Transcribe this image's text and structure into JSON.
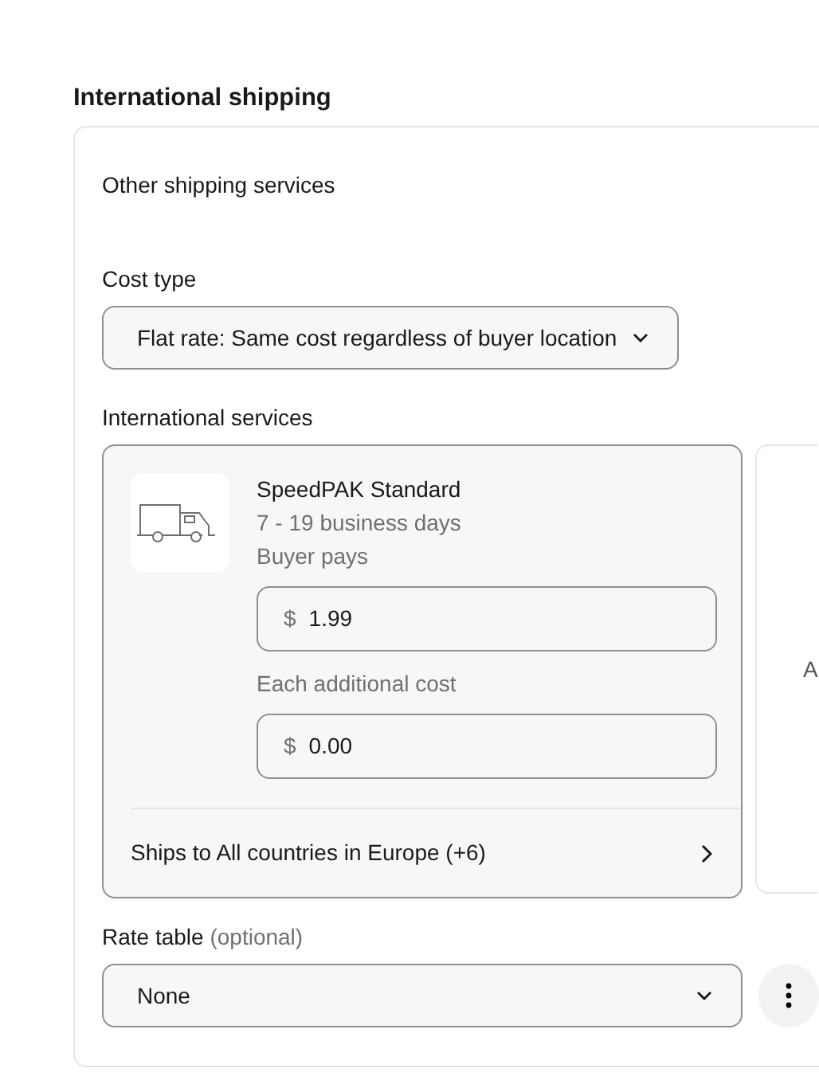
{
  "heading": "International shipping",
  "section_title": "Other shipping services",
  "cost_type": {
    "label": "Cost type",
    "value": "Flat rate: Same cost regardless of buyer location"
  },
  "services_label": "International services",
  "services": [
    {
      "kind": "service",
      "name": "SpeedPAK Standard",
      "delivery": "7 - 19 business days",
      "payer": "Buyer pays",
      "cost": {
        "currency": "$",
        "value": "1.99"
      },
      "additional_label": "Each additional cost",
      "additional_cost": {
        "currency": "$",
        "value": "0.00"
      },
      "ships_to": "Ships to All countries in Europe (+6)"
    },
    {
      "kind": "add",
      "text": "A"
    }
  ],
  "rate_table": {
    "label": "Rate table",
    "hint": "(optional)",
    "value": "None"
  }
}
